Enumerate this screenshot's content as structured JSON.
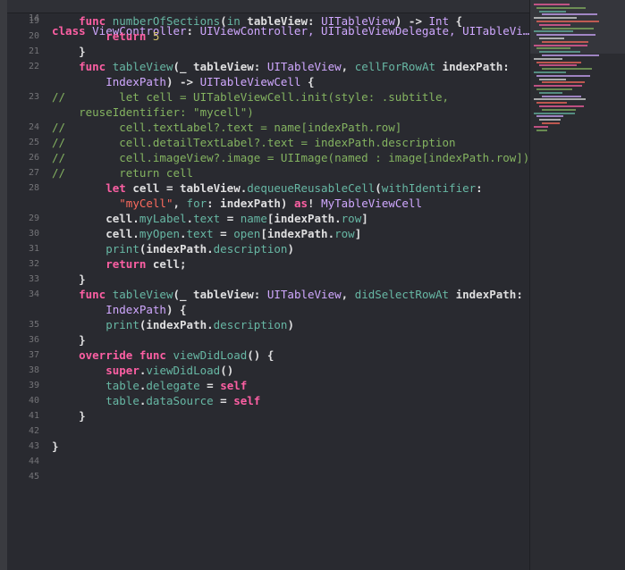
{
  "colors": {
    "background": "#292a30",
    "keyword": "#fc5fa3",
    "comment": "#84b360",
    "string": "#fc6a5d",
    "number": "#d0bf69",
    "function": "#67b7a4",
    "type": "#d0a8ff",
    "plain": "#dfdfe0",
    "line_number": "#747478"
  },
  "sticky": {
    "line_number": "14",
    "text": "class ViewController: UIViewController, UITableViewDelegate, UITableVi…"
  },
  "lines": [
    {
      "n": "19",
      "parts": [
        [
          "p",
          "    "
        ],
        [
          "k",
          "func "
        ],
        [
          "f",
          "numberOfSections"
        ],
        [
          "p",
          "("
        ],
        [
          "f",
          "in"
        ],
        [
          "p",
          " tableView: "
        ],
        [
          "t",
          "UITableView"
        ],
        [
          "p",
          ") -> "
        ],
        [
          "t",
          "Int"
        ],
        [
          "p",
          " {"
        ]
      ]
    },
    {
      "n": "20",
      "parts": [
        [
          "p",
          "        "
        ],
        [
          "k",
          "return "
        ],
        [
          "u",
          "5"
        ]
      ]
    },
    {
      "n": "21",
      "parts": [
        [
          "p",
          "    }"
        ]
      ]
    },
    {
      "n": "22",
      "parts": [
        [
          "p",
          "    "
        ],
        [
          "k",
          "func "
        ],
        [
          "f",
          "tableView"
        ],
        [
          "p",
          "(_ tableView: "
        ],
        [
          "t",
          "UITableView"
        ],
        [
          "p",
          ", "
        ],
        [
          "f",
          "cellForRowAt"
        ],
        [
          "p",
          " indexPath:"
        ]
      ]
    },
    {
      "n": "",
      "parts": [
        [
          "p",
          "        "
        ],
        [
          "t",
          "IndexPath"
        ],
        [
          "p",
          ") -> "
        ],
        [
          "t",
          "UITableViewCell"
        ],
        [
          "p",
          " {"
        ]
      ]
    },
    {
      "n": "23",
      "parts": [
        [
          "c",
          "//        let cell = UITableViewCell.init(style: .subtitle,"
        ]
      ]
    },
    {
      "n": "",
      "parts": [
        [
          "c",
          "    reuseIdentifier: \"mycell\")"
        ]
      ]
    },
    {
      "n": "24",
      "parts": [
        [
          "c",
          "//        cell.textLabel?.text = name[indexPath.row]"
        ]
      ]
    },
    {
      "n": "25",
      "parts": [
        [
          "c",
          "//        cell.detailTextLabel?.text = indexPath.description"
        ]
      ]
    },
    {
      "n": "26",
      "parts": [
        [
          "c",
          "//        cell.imageView?.image = UIImage(named : image[indexPath.row])"
        ]
      ]
    },
    {
      "n": "27",
      "parts": [
        [
          "c",
          "//        return cell"
        ]
      ]
    },
    {
      "n": "28",
      "parts": [
        [
          "p",
          "        "
        ],
        [
          "k",
          "let "
        ],
        [
          "p",
          "cell = tableView."
        ],
        [
          "f",
          "dequeueReusableCell"
        ],
        [
          "p",
          "("
        ],
        [
          "f",
          "withIdentifier"
        ],
        [
          "p",
          ":"
        ]
      ]
    },
    {
      "n": "",
      "parts": [
        [
          "p",
          "          "
        ],
        [
          "s",
          "\"myCell\""
        ],
        [
          "p",
          ", "
        ],
        [
          "f",
          "for"
        ],
        [
          "p",
          ": indexPath) "
        ],
        [
          "k",
          "as"
        ],
        [
          "p",
          "! "
        ],
        [
          "t",
          "MyTableViewCell"
        ]
      ]
    },
    {
      "n": "29",
      "parts": [
        [
          "p",
          "        cell."
        ],
        [
          "f",
          "myLabel"
        ],
        [
          "p",
          "."
        ],
        [
          "f",
          "text"
        ],
        [
          "p",
          " = "
        ],
        [
          "f",
          "name"
        ],
        [
          "p",
          "[indexPath."
        ],
        [
          "f",
          "row"
        ],
        [
          "p",
          "]"
        ]
      ]
    },
    {
      "n": "30",
      "parts": [
        [
          "p",
          "        cell."
        ],
        [
          "f",
          "myOpen"
        ],
        [
          "p",
          "."
        ],
        [
          "f",
          "text"
        ],
        [
          "p",
          " = "
        ],
        [
          "f",
          "open"
        ],
        [
          "p",
          "[indexPath."
        ],
        [
          "f",
          "row"
        ],
        [
          "p",
          "]"
        ]
      ]
    },
    {
      "n": "31",
      "parts": [
        [
          "p",
          "        "
        ],
        [
          "f",
          "print"
        ],
        [
          "p",
          "(indexPath."
        ],
        [
          "f",
          "description"
        ],
        [
          "p",
          ")"
        ]
      ]
    },
    {
      "n": "32",
      "parts": [
        [
          "p",
          "        "
        ],
        [
          "k",
          "return "
        ],
        [
          "p",
          "cell;"
        ]
      ]
    },
    {
      "n": "33",
      "parts": [
        [
          "p",
          "    }"
        ]
      ]
    },
    {
      "n": "34",
      "parts": [
        [
          "p",
          "    "
        ],
        [
          "k",
          "func "
        ],
        [
          "f",
          "tableView"
        ],
        [
          "p",
          "(_ tableView: "
        ],
        [
          "t",
          "UITableView"
        ],
        [
          "p",
          ", "
        ],
        [
          "f",
          "didSelectRowAt"
        ],
        [
          "p",
          " indexPath:"
        ]
      ]
    },
    {
      "n": "",
      "parts": [
        [
          "p",
          "        "
        ],
        [
          "t",
          "IndexPath"
        ],
        [
          "p",
          ") {"
        ]
      ]
    },
    {
      "n": "35",
      "parts": [
        [
          "p",
          "        "
        ],
        [
          "f",
          "print"
        ],
        [
          "p",
          "(indexPath."
        ],
        [
          "f",
          "description"
        ],
        [
          "p",
          ")"
        ]
      ]
    },
    {
      "n": "36",
      "parts": [
        [
          "p",
          "    }"
        ]
      ]
    },
    {
      "n": "37",
      "parts": [
        [
          "p",
          "    "
        ],
        [
          "k",
          "override func "
        ],
        [
          "f",
          "viewDidLoad"
        ],
        [
          "p",
          "() {"
        ]
      ]
    },
    {
      "n": "38",
      "parts": [
        [
          "p",
          "        "
        ],
        [
          "k",
          "super"
        ],
        [
          "p",
          "."
        ],
        [
          "f",
          "viewDidLoad"
        ],
        [
          "p",
          "()"
        ]
      ]
    },
    {
      "n": "39",
      "parts": [
        [
          "p",
          "        "
        ],
        [
          "f",
          "table"
        ],
        [
          "p",
          "."
        ],
        [
          "f",
          "delegate"
        ],
        [
          "p",
          " = "
        ],
        [
          "k",
          "self"
        ]
      ]
    },
    {
      "n": "40",
      "parts": [
        [
          "p",
          "        "
        ],
        [
          "f",
          "table"
        ],
        [
          "p",
          "."
        ],
        [
          "f",
          "dataSource"
        ],
        [
          "p",
          " = "
        ],
        [
          "k",
          "self"
        ]
      ]
    },
    {
      "n": "41",
      "parts": [
        [
          "p",
          "    }"
        ]
      ]
    },
    {
      "n": "42",
      "parts": [
        [
          "p",
          ""
        ]
      ]
    },
    {
      "n": "43",
      "parts": [
        [
          "p",
          "}"
        ]
      ]
    },
    {
      "n": "44",
      "parts": [
        [
          "p",
          ""
        ]
      ]
    },
    {
      "n": "45",
      "parts": [
        [
          "p",
          ""
        ]
      ]
    }
  ]
}
